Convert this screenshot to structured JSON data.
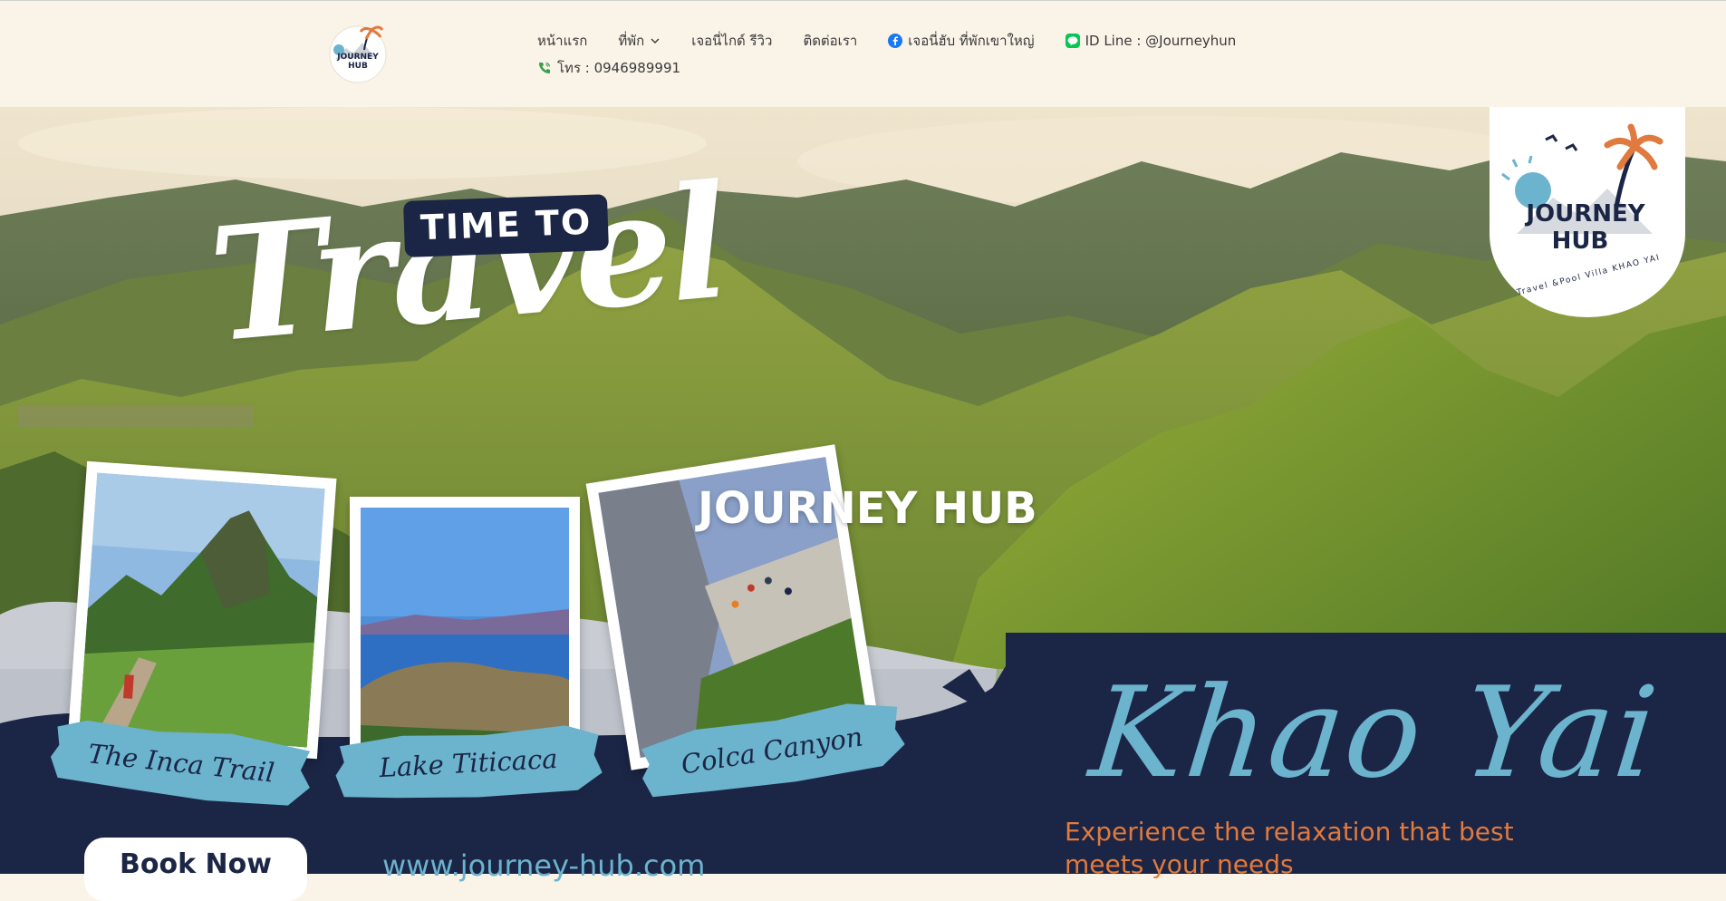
{
  "header": {
    "logo_alt": "Journey Hub logo",
    "nav": [
      {
        "label": "หน้าแรก"
      },
      {
        "label": "ที่พัก"
      },
      {
        "label": "เจอนี่ไกด์ รีวิว"
      },
      {
        "label": "ติดต่อเรา"
      },
      {
        "label": "เจอนี่ฮับ ที่พักเขาใหญ่",
        "icon": "facebook-icon"
      },
      {
        "label": "ID Line : @Journeyhun",
        "icon": "line-icon"
      },
      {
        "label": "โทร : 0946989991",
        "icon": "phone-icon"
      }
    ]
  },
  "hero": {
    "time_to": "TIME TO",
    "travel": "Travel",
    "brand": "JOURNEY HUB",
    "logo_badge": {
      "line1": "JOURNEY",
      "line2": "HUB",
      "tagline": "Travel &Pool Villa KHAO YAI"
    },
    "cards": [
      {
        "label": "The Inca Trail"
      },
      {
        "label": "Lake Titicaca"
      },
      {
        "label": "Colca Canyon"
      }
    ],
    "headline": "Khao Yai",
    "tagline": "Experience the relaxation that best meets your needs",
    "cta": "Book Now",
    "website": "www.journey-hub.com"
  },
  "colors": {
    "navy": "#1b2545",
    "accent_blue": "#6cb3cd",
    "accent_orange": "#e07a3e",
    "header_bg": "#faf3e8"
  }
}
